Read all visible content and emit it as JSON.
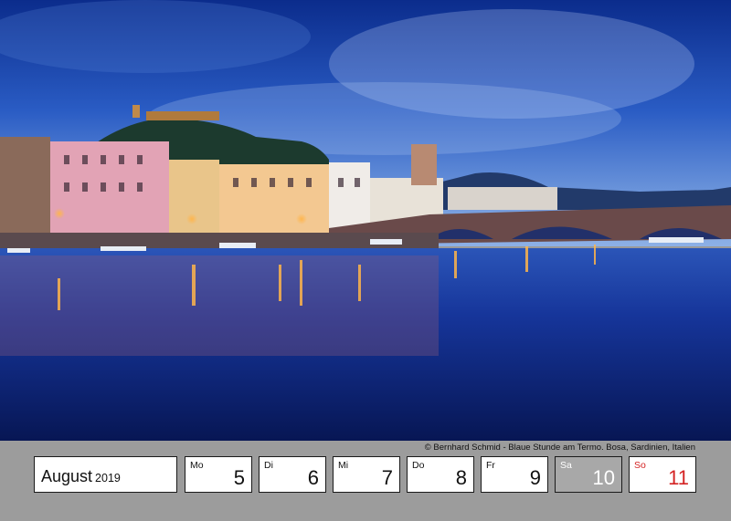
{
  "calendar": {
    "month": "August",
    "year": "2019",
    "credit": "© Bernhard Schmid - Blaue Stunde am Termo. Bosa, Sardinien, Italien",
    "days": [
      {
        "abbr": "Mo",
        "num": "5"
      },
      {
        "abbr": "Di",
        "num": "6"
      },
      {
        "abbr": "Mi",
        "num": "7"
      },
      {
        "abbr": "Do",
        "num": "8"
      },
      {
        "abbr": "Fr",
        "num": "9"
      },
      {
        "abbr": "Sa",
        "num": "10"
      },
      {
        "abbr": "So",
        "num": "11"
      }
    ]
  },
  "colors": {
    "strip": "#9c9c9c",
    "saturday_bg": "#a8a8a8",
    "sunday_text": "#d42424",
    "sky_top": "#0d2f8f",
    "water": "#0b1f63"
  }
}
